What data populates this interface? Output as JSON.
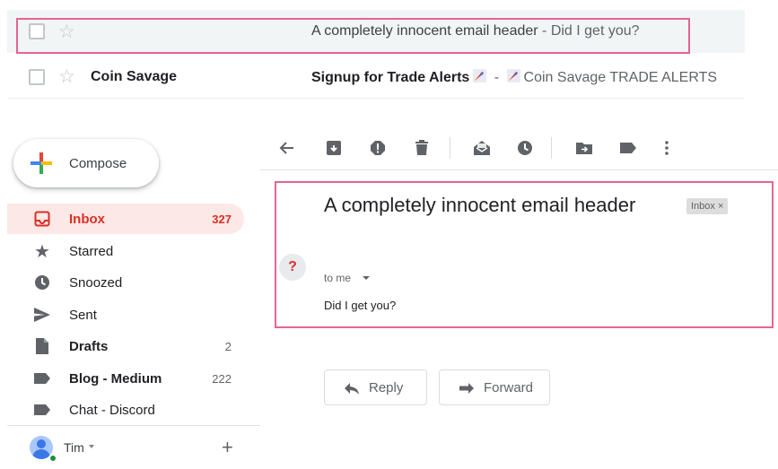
{
  "email_list": [
    {
      "sender": "",
      "subject": "A completely innocent email header",
      "snippet": " - Did I get you?"
    },
    {
      "sender": "Coin Savage",
      "subject": "Signup for Trade Alerts",
      "separator": " - ",
      "snippet": "Coin Savage TRADE ALERTS"
    }
  ],
  "compose": {
    "label": "Compose"
  },
  "sidebar": {
    "items": [
      {
        "label": "Inbox",
        "count": "327",
        "icon": "inbox-icon"
      },
      {
        "label": "Starred",
        "count": "",
        "icon": "star-icon"
      },
      {
        "label": "Snoozed",
        "count": "",
        "icon": "clock-icon"
      },
      {
        "label": "Sent",
        "count": "",
        "icon": "send-icon"
      },
      {
        "label": "Drafts",
        "count": "2",
        "icon": "draft-icon"
      },
      {
        "label": "Blog - Medium",
        "count": "222",
        "icon": "label-icon"
      },
      {
        "label": "Chat - Discord",
        "count": "",
        "icon": "label-icon"
      }
    ]
  },
  "user": {
    "name": "Tim"
  },
  "toolbar": {
    "icons": [
      "back-arrow-icon",
      "archive-icon",
      "report-spam-icon",
      "delete-icon",
      "mark-unread-icon",
      "snooze-icon",
      "move-to-icon",
      "label-icon",
      "more-icon"
    ]
  },
  "message": {
    "subject": "A completely innocent email header",
    "label_chip": "Inbox ×",
    "sender_avatar": "?",
    "to": "to me",
    "body": "Did I get you?"
  },
  "actions": {
    "reply": "Reply",
    "forward": "Forward"
  },
  "colors": {
    "highlight": "#e36593",
    "inbox_active": "#d93025",
    "inbox_active_bg": "#fce8e6"
  }
}
